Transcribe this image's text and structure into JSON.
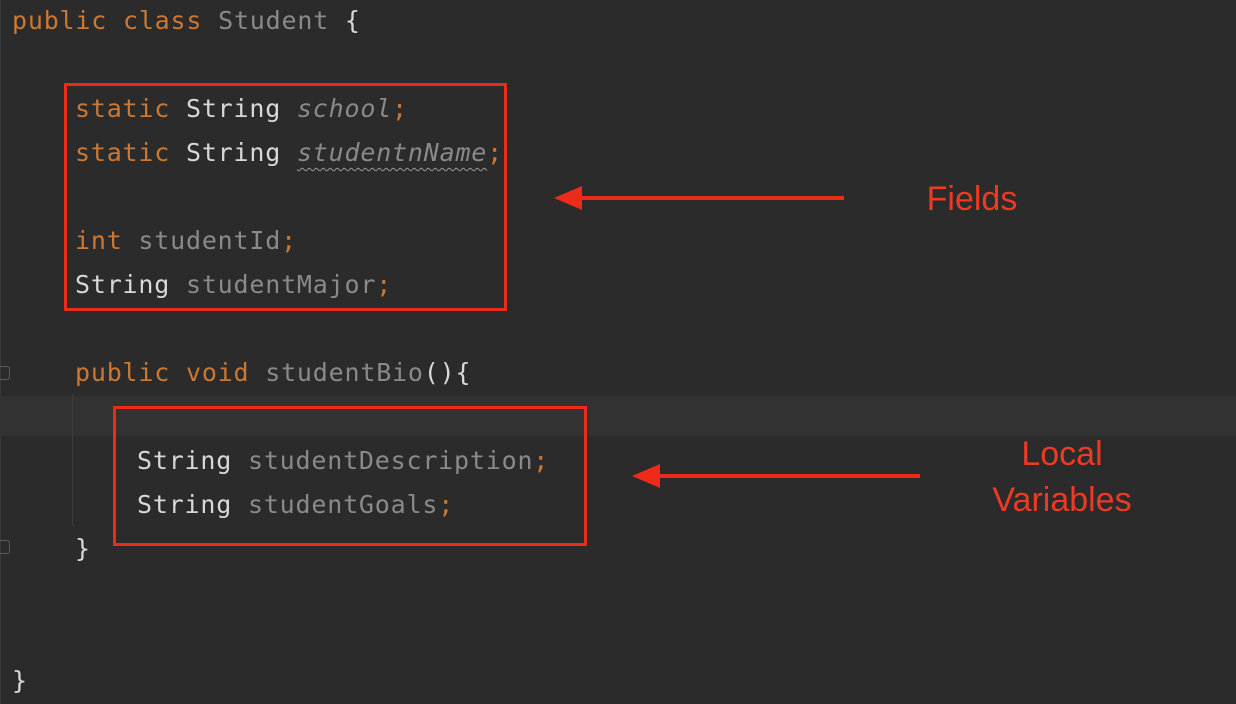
{
  "code": {
    "class_decl": {
      "modifier": "public",
      "keyword": "class",
      "name": "Student",
      "brace": "{"
    },
    "fields": [
      {
        "modifier": "static",
        "type": "String",
        "name": "school",
        "semi": ";"
      },
      {
        "modifier": "static",
        "type": "String",
        "name": "studentnName",
        "semi": ";"
      },
      {
        "type": "int",
        "name": "studentId",
        "semi": ";"
      },
      {
        "type": "String",
        "name": "studentMajor",
        "semi": ";"
      }
    ],
    "method_decl": {
      "modifier": "public",
      "return_type": "void",
      "name": "studentBio",
      "parens": "()",
      "brace": "{"
    },
    "locals": [
      {
        "type": "String",
        "name": "studentDescription",
        "semi": ";"
      },
      {
        "type": "String",
        "name": "studentGoals",
        "semi": ";"
      }
    ],
    "method_close": "}",
    "class_close": "}"
  },
  "annotations": {
    "fields_label": "Fields",
    "locals_label_line1": "Local",
    "locals_label_line2": "Variables"
  },
  "colors": {
    "keyword": "#cc7832",
    "type": "#d8d8d8",
    "identifier": "#8a8a8a",
    "annotation": "#ee3a24",
    "background": "#2b2b2b"
  }
}
